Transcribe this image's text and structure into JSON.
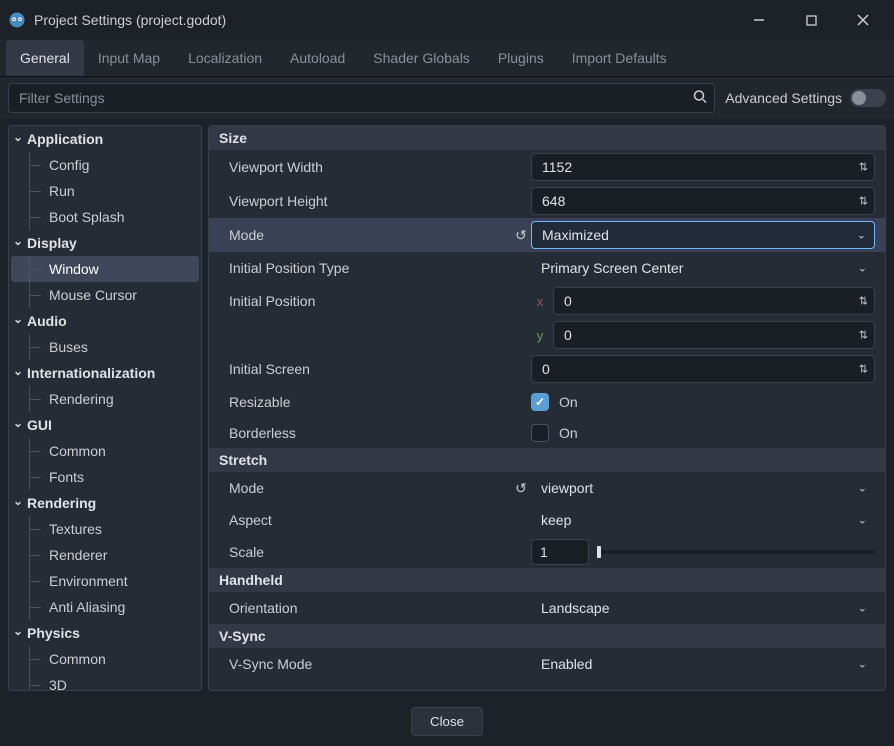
{
  "window": {
    "title": "Project Settings (project.godot)"
  },
  "tabs": [
    "General",
    "Input Map",
    "Localization",
    "Autoload",
    "Shader Globals",
    "Plugins",
    "Import Defaults"
  ],
  "active_tab": 0,
  "search_placeholder": "Filter Settings",
  "advanced_label": "Advanced Settings",
  "sidebar": [
    {
      "label": "Application",
      "items": [
        "Config",
        "Run",
        "Boot Splash"
      ]
    },
    {
      "label": "Display",
      "items": [
        "Window",
        "Mouse Cursor"
      ],
      "selected": 0
    },
    {
      "label": "Audio",
      "items": [
        "Buses"
      ]
    },
    {
      "label": "Internationalization",
      "items": [
        "Rendering"
      ]
    },
    {
      "label": "GUI",
      "items": [
        "Common",
        "Fonts"
      ]
    },
    {
      "label": "Rendering",
      "items": [
        "Textures",
        "Renderer",
        "Environment",
        "Anti Aliasing"
      ]
    },
    {
      "label": "Physics",
      "items": [
        "Common",
        "3D"
      ]
    }
  ],
  "sections": {
    "size": {
      "header": "Size",
      "viewport_width": {
        "label": "Viewport Width",
        "value": "1152"
      },
      "viewport_height": {
        "label": "Viewport Height",
        "value": "648"
      },
      "mode": {
        "label": "Mode",
        "value": "Maximized"
      },
      "initial_position_type": {
        "label": "Initial Position Type",
        "value": "Primary Screen Center"
      },
      "initial_position": {
        "label": "Initial Position",
        "x": "0",
        "y": "0"
      },
      "initial_screen": {
        "label": "Initial Screen",
        "value": "0"
      },
      "resizable": {
        "label": "Resizable",
        "value": "On",
        "checked": true
      },
      "borderless": {
        "label": "Borderless",
        "value": "On",
        "checked": false
      }
    },
    "stretch": {
      "header": "Stretch",
      "mode": {
        "label": "Mode",
        "value": "viewport"
      },
      "aspect": {
        "label": "Aspect",
        "value": "keep"
      },
      "scale": {
        "label": "Scale",
        "value": "1"
      }
    },
    "handheld": {
      "header": "Handheld",
      "orientation": {
        "label": "Orientation",
        "value": "Landscape"
      }
    },
    "vsync": {
      "header": "V-Sync",
      "mode": {
        "label": "V-Sync Mode",
        "value": "Enabled"
      }
    }
  },
  "close_label": "Close"
}
